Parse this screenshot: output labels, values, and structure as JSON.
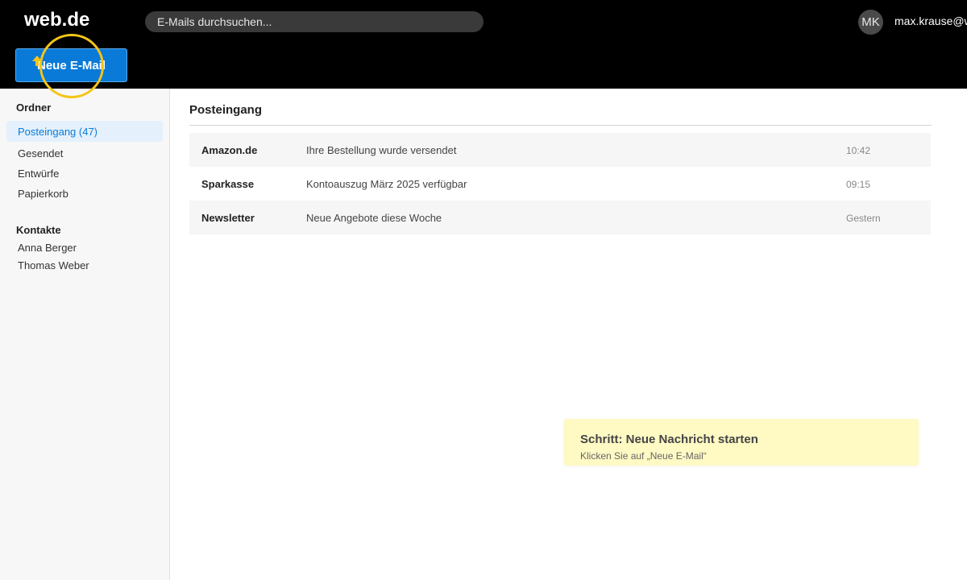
{
  "header": {
    "logo": "web.de",
    "search_placeholder": "E-Mails durchsuchen...",
    "avatar_initials": "MK",
    "user_email": "max.krause@web.de"
  },
  "compose_label": "Neue E-Mail",
  "sidebar": {
    "folders_title": "Ordner",
    "folders": [
      {
        "label": "Posteingang (47)",
        "active": true
      },
      {
        "label": "Gesendet"
      },
      {
        "label": "Entwürfe"
      },
      {
        "label": "Papierkorb"
      }
    ],
    "contacts_title": "Kontakte",
    "contacts": [
      {
        "label": "Anna Berger"
      },
      {
        "label": "Thomas Weber"
      }
    ]
  },
  "main": {
    "title": "Posteingang",
    "emails": [
      {
        "sender": "Amazon.de",
        "subject": "Ihre Bestellung wurde versendet",
        "time": "10:42"
      },
      {
        "sender": "Sparkasse",
        "subject": "Kontoauszug März 2025 verfügbar",
        "time": "09:15"
      },
      {
        "sender": "Newsletter",
        "subject": "Neue Angebote diese Woche",
        "time": "Gestern"
      }
    ]
  },
  "hint": {
    "title": "Schritt: Neue Nachricht starten",
    "text": "Klicken Sie auf „Neue E-Mail“"
  },
  "colors": {
    "accent": "#0a7ad8",
    "header_bg": "#000000",
    "highlight_ring": "#f5c518",
    "hint_bg": "#fff9c4"
  }
}
